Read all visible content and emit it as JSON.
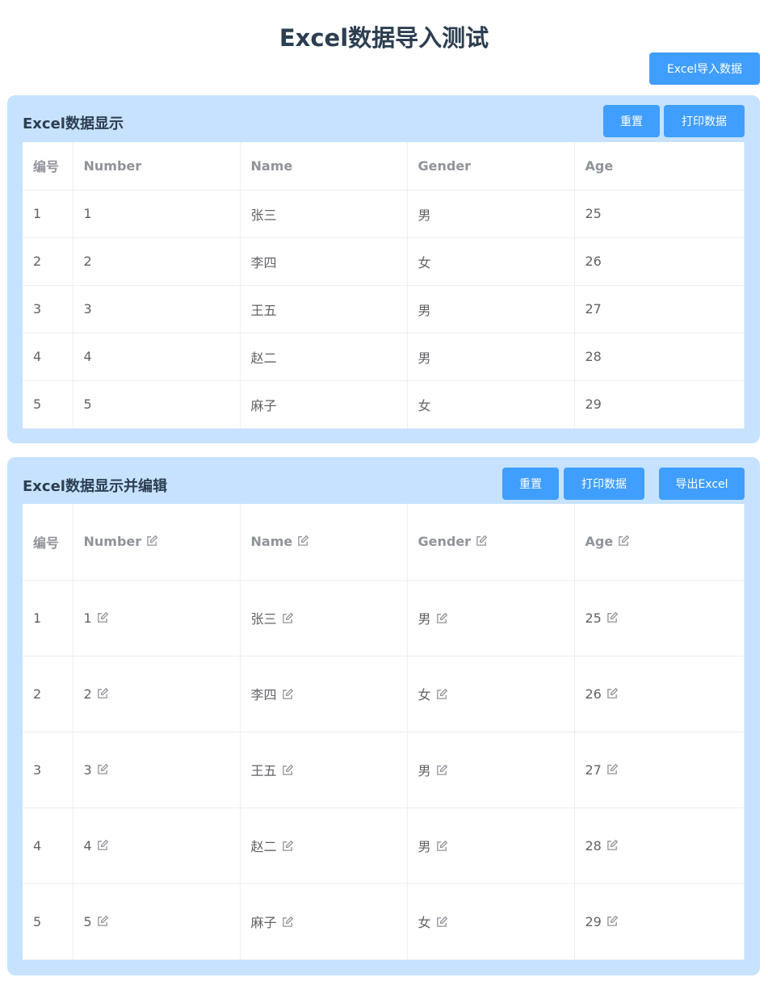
{
  "page": {
    "title": "Excel数据导入测试",
    "import_button": "Excel导入数据"
  },
  "panel1": {
    "title": "Excel数据显示",
    "reset_button": "重置",
    "print_button": "打印数据",
    "columns": [
      "编号",
      "Number",
      "Name",
      "Gender",
      "Age"
    ],
    "rows": [
      [
        "1",
        "1",
        "张三",
        "男",
        "25"
      ],
      [
        "2",
        "2",
        "李四",
        "女",
        "26"
      ],
      [
        "3",
        "3",
        "王五",
        "男",
        "27"
      ],
      [
        "4",
        "4",
        "赵二",
        "男",
        "28"
      ],
      [
        "5",
        "5",
        "麻子",
        "女",
        "29"
      ]
    ]
  },
  "panel2": {
    "title": "Excel数据显示并编辑",
    "reset_button": "重置",
    "print_button": "打印数据",
    "export_button": "导出Excel",
    "columns": [
      "编号",
      "Number",
      "Name",
      "Gender",
      "Age"
    ],
    "rows": [
      [
        "1",
        "1",
        "张三",
        "男",
        "25"
      ],
      [
        "2",
        "2",
        "李四",
        "女",
        "26"
      ],
      [
        "3",
        "3",
        "王五",
        "男",
        "27"
      ],
      [
        "4",
        "4",
        "赵二",
        "男",
        "28"
      ],
      [
        "5",
        "5",
        "麻子",
        "女",
        "29"
      ]
    ]
  },
  "icons": {
    "edit": "edit-icon"
  }
}
